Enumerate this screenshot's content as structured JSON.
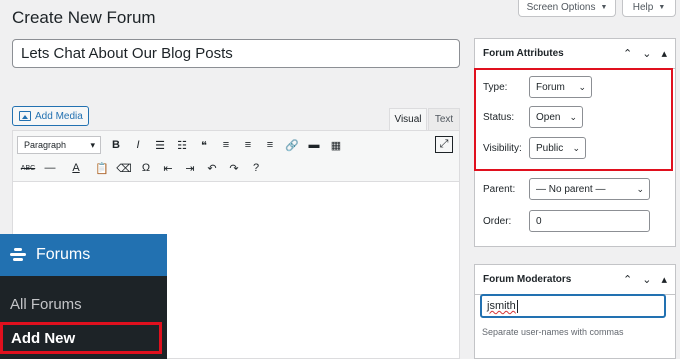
{
  "page": {
    "title": "Create New Forum"
  },
  "top_tabs": {
    "screen_options": "Screen Options",
    "help": "Help"
  },
  "title_input": {
    "value": "Lets Chat About Our Blog Posts"
  },
  "editor": {
    "add_media": "Add Media",
    "tab_visual": "Visual",
    "tab_text": "Text",
    "format_select": "Paragraph",
    "toolbar_row1": [
      {
        "name": "bold-icon",
        "glyph": "B"
      },
      {
        "name": "italic-icon",
        "glyph": "I"
      },
      {
        "name": "bullet-list-icon",
        "glyph": "☰"
      },
      {
        "name": "numbered-list-icon",
        "glyph": "☷"
      },
      {
        "name": "blockquote-icon",
        "glyph": "❝"
      },
      {
        "name": "align-left-icon",
        "glyph": "≡"
      },
      {
        "name": "align-center-icon",
        "glyph": "≡"
      },
      {
        "name": "align-right-icon",
        "glyph": "≡"
      },
      {
        "name": "link-icon",
        "glyph": "🔗"
      },
      {
        "name": "read-more-icon",
        "glyph": "▬"
      },
      {
        "name": "toolbar-toggle-icon",
        "glyph": "▦"
      }
    ],
    "toolbar_row2": [
      {
        "name": "strikethrough-icon",
        "glyph": "ABC"
      },
      {
        "name": "horizontal-line-icon",
        "glyph": "—"
      },
      {
        "name": "text-color-icon",
        "glyph": "A"
      },
      {
        "name": "paste-text-icon",
        "glyph": "📋"
      },
      {
        "name": "clear-formatting-icon",
        "glyph": "⌫"
      },
      {
        "name": "special-character-icon",
        "glyph": "Ω"
      },
      {
        "name": "outdent-icon",
        "glyph": "⇤"
      },
      {
        "name": "indent-icon",
        "glyph": "⇥"
      },
      {
        "name": "undo-icon",
        "glyph": "↶"
      },
      {
        "name": "redo-icon",
        "glyph": "↷"
      },
      {
        "name": "help-icon",
        "glyph": "?"
      }
    ]
  },
  "sidebar": {
    "header": "Forums",
    "items": [
      {
        "label": "All Forums"
      },
      {
        "label": "Add New"
      }
    ]
  },
  "forum_attributes": {
    "title": "Forum Attributes",
    "type": {
      "label": "Type:",
      "value": "Forum"
    },
    "status": {
      "label": "Status:",
      "value": "Open"
    },
    "visibility": {
      "label": "Visibility:",
      "value": "Public"
    },
    "parent": {
      "label": "Parent:",
      "value": "— No parent —"
    },
    "order": {
      "label": "Order:",
      "value": "0"
    }
  },
  "forum_moderators": {
    "title": "Forum Moderators",
    "input_value": "jsmith",
    "help_text": "Separate user-names with commas"
  },
  "colors": {
    "accent": "#2271b1",
    "highlight": "#e0101e",
    "sidebar": "#1d2327"
  }
}
